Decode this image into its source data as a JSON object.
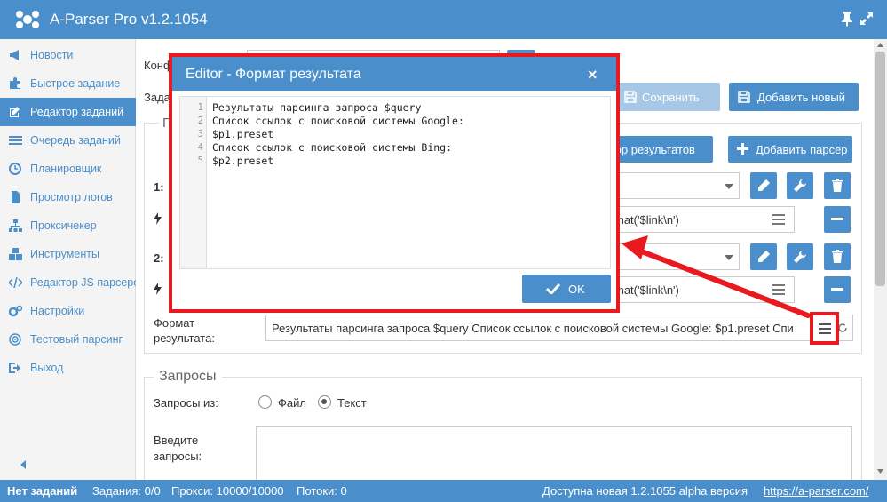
{
  "app": {
    "title": "A-Parser Pro v1.2.1054"
  },
  "sidebar": {
    "items": [
      {
        "label": "Новости",
        "icon": "bullhorn-icon"
      },
      {
        "label": "Быстрое задание",
        "icon": "puzzle-icon"
      },
      {
        "label": "Редактор заданий",
        "icon": "edit-icon"
      },
      {
        "label": "Очередь заданий",
        "icon": "list-icon"
      },
      {
        "label": "Планировщик",
        "icon": "clock-icon"
      },
      {
        "label": "Просмотр логов",
        "icon": "file-icon"
      },
      {
        "label": "Проксичекер",
        "icon": "sitemap-icon"
      },
      {
        "label": "Инструменты",
        "icon": "cubes-icon"
      },
      {
        "label": "Редактор JS парсеров",
        "icon": "code-icon"
      },
      {
        "label": "Настройки",
        "icon": "gears-icon"
      },
      {
        "label": "Тестовый парсинг",
        "icon": "target-icon"
      },
      {
        "label": "Выход",
        "icon": "sign-out-icon"
      }
    ],
    "active_index": 2
  },
  "main": {
    "config_label": "Конф",
    "task_label": "Зада",
    "parsers_legend": "П",
    "save_button": "Сохранить",
    "add_new_button": "Добавить новый",
    "result_builder_button": "ктор результатов",
    "add_parser_button": "Добавить парсер",
    "parser1_label": "1:",
    "parser2_label": "2:",
    "parser1_format": "mat('$link\\n')",
    "parser2_format": "mat('$link\\n')",
    "result_format_label_1": "Формат",
    "result_format_label_2": "результата:",
    "result_format_value": "Результаты парсинга запроса $query Список ссылок с поисковой системы Google: $p1.preset Спи",
    "queries_legend": "Запросы",
    "queries_from_label": "Запросы из:",
    "queries_option_file": "Файл",
    "queries_option_text": "Текст",
    "queries_selected": "Текст",
    "enter_queries_label_1": "Введите",
    "enter_queries_label_2": "запросы:"
  },
  "modal": {
    "title": "Editor - Формат результата",
    "close_glyph": "×",
    "lines": [
      {
        "n": "1",
        "text": "Результаты парсинга запроса $query"
      },
      {
        "n": "2",
        "text": "Список ссылок с поисковой системы Google:"
      },
      {
        "n": "3",
        "text": "$p1.preset"
      },
      {
        "n": "4",
        "text": "Список ссылок с поисковой системы Bing:"
      },
      {
        "n": "5",
        "text": "$p2.preset"
      }
    ],
    "ok_button": "OK"
  },
  "statusbar": {
    "no_tasks": "Нет заданий",
    "tasks": "Задания: 0/0",
    "proxies": "Прокси: 10000/10000",
    "threads": "Потоки: 0",
    "update_notice": "Доступна новая 1.2.1055 alpha версия",
    "link": "https://a-parser.com/"
  },
  "colors": {
    "accent": "#4a8fcb",
    "highlight": "#e8191f",
    "disabled": "#a6c8e6"
  }
}
